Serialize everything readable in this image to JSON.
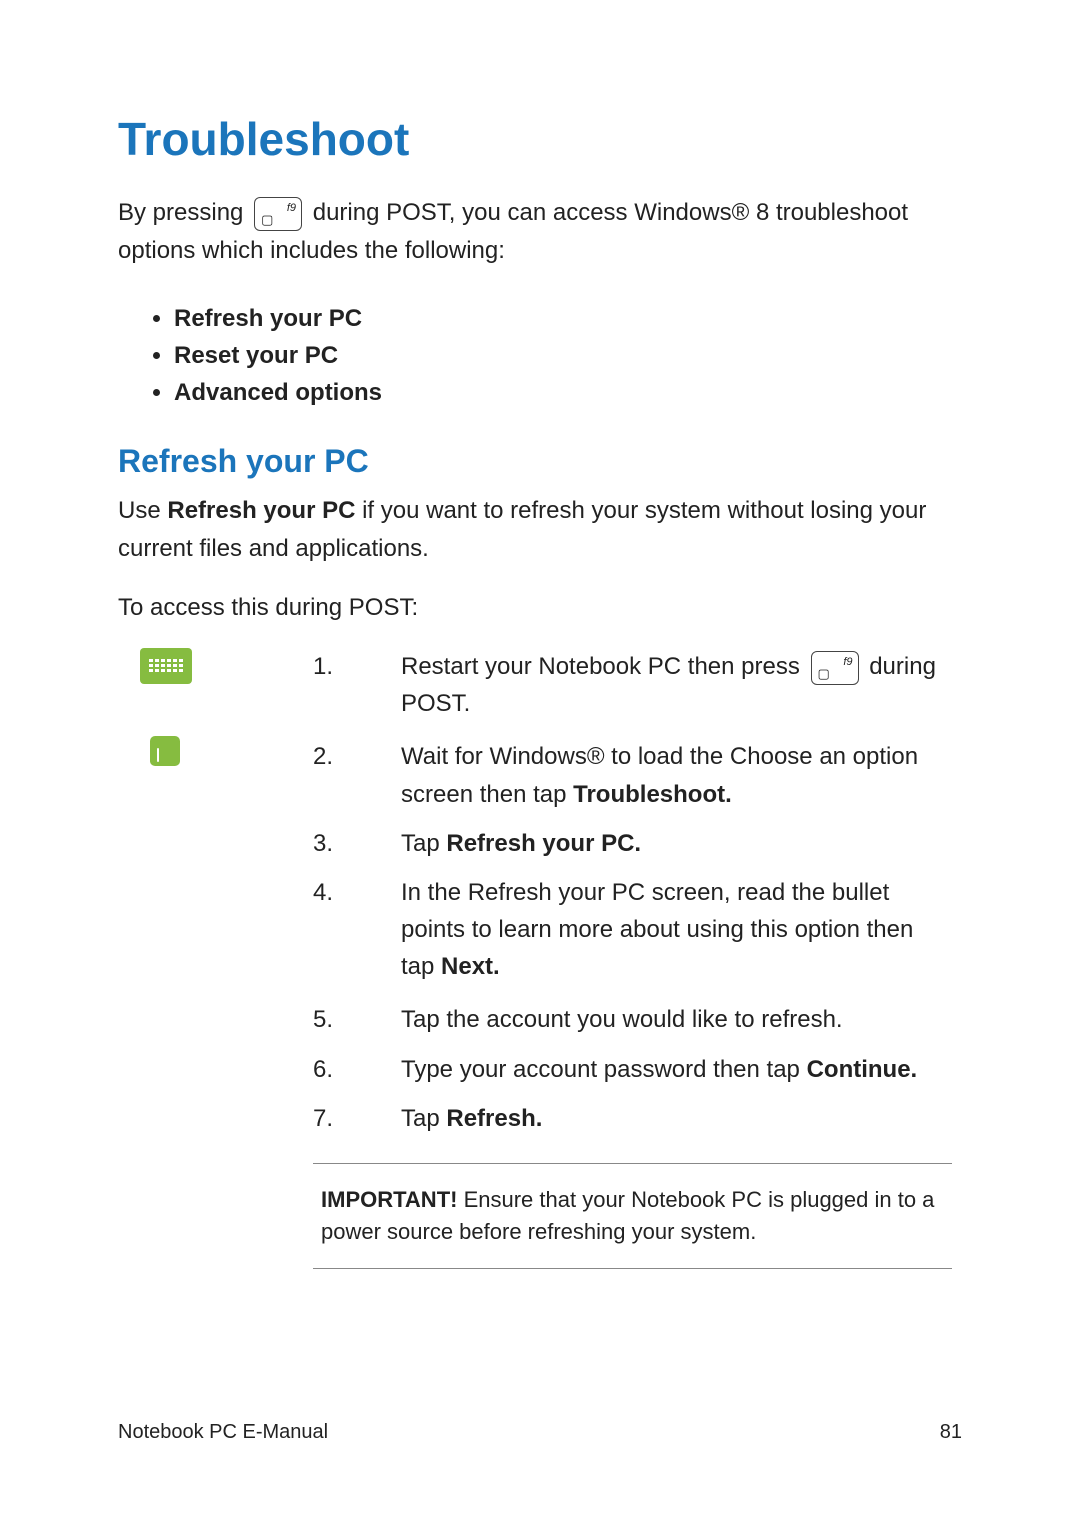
{
  "heading": "Troubleshoot",
  "intro_before_key": "By pressing ",
  "key_label": "f9",
  "intro_after_key": " during POST, you can access Windows® 8 troubleshoot options which includes the following:",
  "bullet_items": {
    "b1": "Refresh your PC",
    "b2": "Reset your PC",
    "b3": "Advanced options"
  },
  "subheading": "Refresh your PC",
  "refresh_para_prefix": "Use ",
  "refresh_para_bold": "Refresh your PC",
  "refresh_para_suffix": " if you want to refresh your system without losing your current files and applications.",
  "access_line": "To access this during POST:",
  "steps": {
    "s1_before": "Restart your Notebook PC then press ",
    "s1_after": " during POST.",
    "s2_a": "Wait for Windows® to load the Choose an option screen then tap ",
    "s2_bold": "Troubleshoot.",
    "s3_a": "Tap ",
    "s3_bold": "Refresh your PC.",
    "s4_a": "In the Refresh your PC screen, read the bullet points to learn more about using this option then tap ",
    "s4_bold": "Next.",
    "s5": "Tap the account you would like to refresh.",
    "s6_a": "Type your account password then tap ",
    "s6_bold": "Continue.",
    "s7_a": "Tap ",
    "s7_bold": "Refresh."
  },
  "note": {
    "label": "IMPORTANT!",
    "text": " Ensure that your Notebook PC is plugged in to a power source before refreshing your system."
  },
  "footer_left": "Notebook PC E-Manual",
  "footer_right": "81"
}
